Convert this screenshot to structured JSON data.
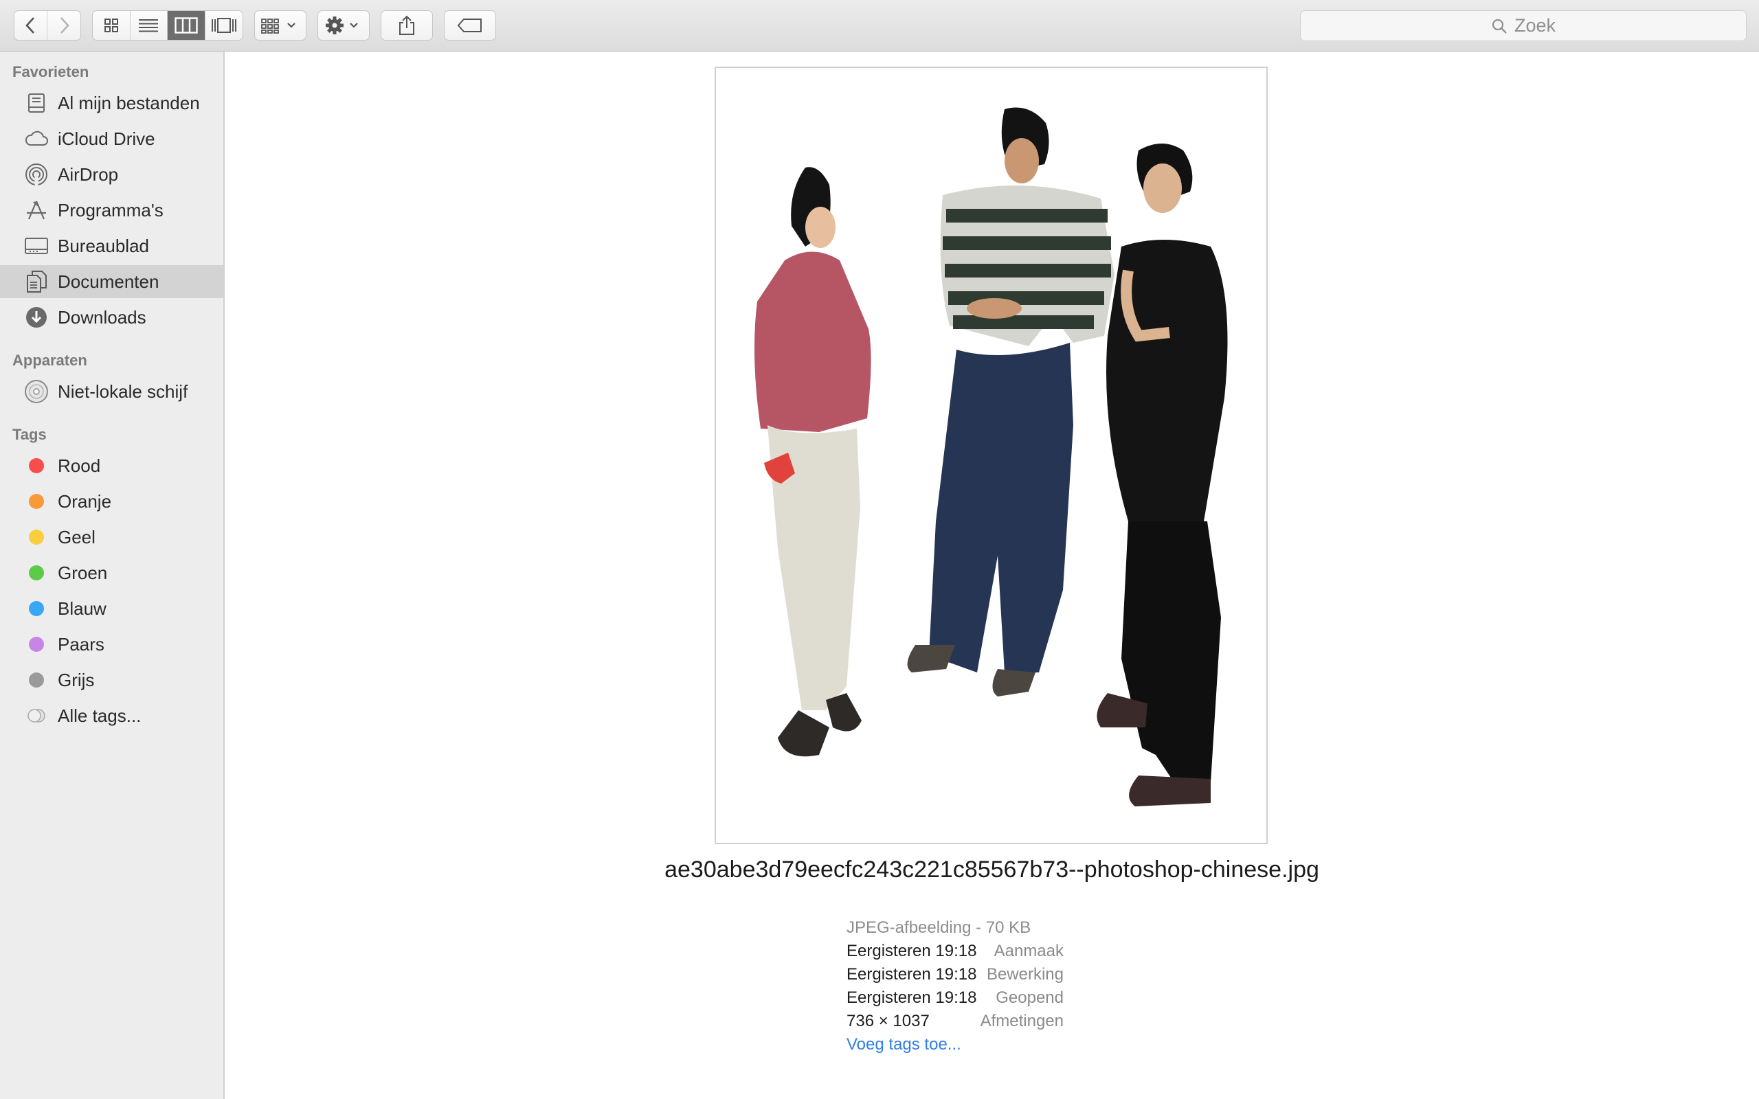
{
  "toolbar": {
    "back_icon": "chevron-left-icon",
    "forward_icon": "chevron-right-icon",
    "view_modes": [
      "icon-view-icon",
      "list-view-icon",
      "column-view-icon",
      "cover-flow-icon"
    ],
    "active_view": "column-view-icon",
    "arrange_icon": "arrange-grid-icon",
    "action_icon": "gear-icon",
    "share_icon": "share-icon",
    "tag_icon": "tag-icon",
    "search_placeholder": "Zoek"
  },
  "sidebar": {
    "favorites_heading": "Favorieten",
    "favorites": [
      {
        "label": "Al mijn bestanden",
        "icon": "all-files-icon"
      },
      {
        "label": "iCloud Drive",
        "icon": "cloud-icon"
      },
      {
        "label": "AirDrop",
        "icon": "airdrop-icon"
      },
      {
        "label": "Programma's",
        "icon": "applications-icon"
      },
      {
        "label": "Bureaublad",
        "icon": "desktop-icon"
      },
      {
        "label": "Documenten",
        "icon": "documents-icon",
        "selected": true
      },
      {
        "label": "Downloads",
        "icon": "downloads-icon"
      }
    ],
    "devices_heading": "Apparaten",
    "devices": [
      {
        "label": "Niet-lokale schijf",
        "icon": "optical-disc-icon"
      }
    ],
    "tags_heading": "Tags",
    "tags": [
      {
        "label": "Rood",
        "color": "#f74e4c"
      },
      {
        "label": "Oranje",
        "color": "#f89a39"
      },
      {
        "label": "Geel",
        "color": "#f9cf3d"
      },
      {
        "label": "Groen",
        "color": "#5ccb47"
      },
      {
        "label": "Blauw",
        "color": "#38a7f5"
      },
      {
        "label": "Paars",
        "color": "#c985e3"
      },
      {
        "label": "Grijs",
        "color": "#9a9a9a"
      },
      {
        "label": "Alle tags...",
        "color": "all-tags"
      }
    ]
  },
  "preview": {
    "filename": "ae30abe3d79eecfc243c221c85567b73--photoshop-chinese.jpg",
    "kind": "JPEG-afbeelding - 70 KB",
    "meta": [
      {
        "key": "Aanmaak",
        "value": "Eergisteren 19:18"
      },
      {
        "key": "Bewerking",
        "value": "Eergisteren 19:18"
      },
      {
        "key": "Geopend",
        "value": "Eergisteren 19:18"
      },
      {
        "key": "Afmetingen",
        "value": "736 × 1037"
      }
    ],
    "add_tags": "Voeg tags toe..."
  }
}
